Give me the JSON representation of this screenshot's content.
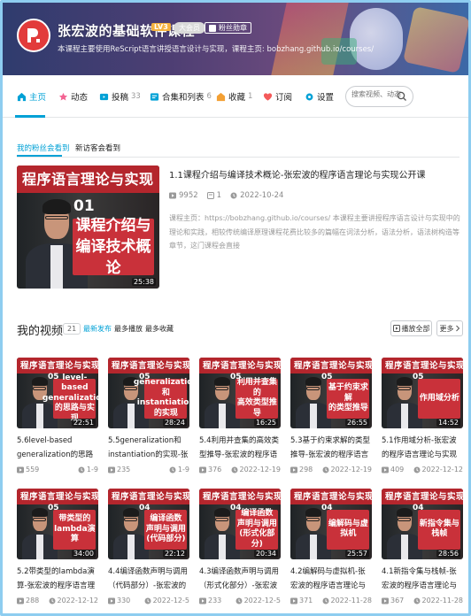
{
  "banner": {
    "username": "张宏波的基础软件课程",
    "level": "LV3",
    "vip_badge": "大会员",
    "fans_badge": "粉丝勋章",
    "signature": "本课程主要使用ReScript语言讲授语言设计与实现，课程主页: bobzhang.github.io/courses/"
  },
  "nav": {
    "items": [
      {
        "label": "主页",
        "count": ""
      },
      {
        "label": "动态",
        "count": ""
      },
      {
        "label": "投稿",
        "count": "33"
      },
      {
        "label": "合集和列表",
        "count": "6"
      },
      {
        "label": "收藏",
        "count": "1"
      },
      {
        "label": "订阅",
        "count": ""
      },
      {
        "label": "设置",
        "count": ""
      }
    ],
    "search_placeholder": "搜索视频、动态"
  },
  "subtabs": [
    "我的粉丝会看到",
    "新访客会看到"
  ],
  "featured": {
    "thumb_bar": "程序语言理论与实现",
    "thumb_num": "01",
    "thumb_box": [
      "课程介绍与",
      "编译技术概论"
    ],
    "duration": "25:38",
    "title": "1.1课程介绍与编译技术概论-张宏波的程序语言理论与实现公开课",
    "views": "9952",
    "comments": "1",
    "date": "2022-10-24",
    "description": "课程主页：https://bobzhang.github.io/courses/ 本课程主要讲授程序语言设计与实现中的理论和实践，相较传统编译原理课程花费比较多的篇幅在词法分析，语法分析，语法树构造等章节，这门课程会直接"
  },
  "section": {
    "title": "我的视频",
    "count": "21",
    "tabs": [
      "最新发布",
      "最多播放",
      "最多收藏"
    ],
    "play_all": "播放全部",
    "more": "更多"
  },
  "videos": [
    {
      "bar": "程序语言理论与实现",
      "num": "05",
      "box": [
        "level-based",
        "generalization",
        "的思路与实现"
      ],
      "duration": "22:51",
      "title": "5.6level-based generalization的思路与实现-",
      "views": "559",
      "date": "1-9"
    },
    {
      "bar": "程序语言理论与实现",
      "num": "05",
      "box": [
        "generalization和",
        "instantiation的实现"
      ],
      "duration": "28:24",
      "title": "5.5generalization和instantiation的实现-张宏波",
      "views": "235",
      "date": "1-9"
    },
    {
      "bar": "程序语言理论与实现",
      "num": "05",
      "box": [
        "利用并查集的",
        "高效类型推导"
      ],
      "duration": "16:25",
      "title": "5.4利用并查集的高效类型推导-张宏波的程序语",
      "views": "376",
      "date": "2022-12-19"
    },
    {
      "bar": "程序语言理论与实现",
      "num": "05",
      "box": [
        "基于约束求解",
        "的类型推导"
      ],
      "duration": "26:55",
      "title": "5.3基于约束求解的类型推导-张宏波的程序语言理论与实现公开课",
      "views": "298",
      "date": "2022-12-19"
    },
    {
      "bar": "程序语言理论与实现",
      "num": "05",
      "box": [
        "作用域分析"
      ],
      "duration": "14:52",
      "title": "5.1作用域分析-张宏波的程序语言理论与实现公开课",
      "views": "409",
      "date": "2022-12-12"
    },
    {
      "bar": "程序语言理论与实现",
      "num": "05",
      "box": [
        "带类型的",
        "lambda演算"
      ],
      "duration": "34:00",
      "title": "5.2带类型的lambda演算-张宏波的程序语言理论与实现公",
      "views": "288",
      "date": "2022-12-12"
    },
    {
      "bar": "程序语言理论与实现",
      "num": "04",
      "box": [
        "编译函数",
        "声明与调用",
        "(代码部分)"
      ],
      "duration": "22:12",
      "title": "4.4编译函数声明与调用（代码部分）-张宏波的程序语言",
      "views": "330",
      "date": "2022-12-5"
    },
    {
      "bar": "程序语言理论与实现",
      "num": "04",
      "box": [
        "编译函数",
        "声明与调用",
        "(形式化部分)"
      ],
      "duration": "20:34",
      "title": "4.3编译函数声明与调用（形式化部分）-张宏波的程序语",
      "views": "233",
      "date": "2022-12-5"
    },
    {
      "bar": "程序语言理论与实现",
      "num": "04",
      "box": [
        "编解码与虚拟机"
      ],
      "duration": "25:57",
      "title": "4.2编解码与虚拟机-张宏波的程序语言理论与实现公开课",
      "views": "371",
      "date": "2022-11-28"
    },
    {
      "bar": "程序语言理论与实现",
      "num": "04",
      "box": [
        "新指令集与栈帧"
      ],
      "duration": "28:56",
      "title": "4.1新指令集与栈帧-张宏波的程序语言理论与实现公开课",
      "views": "367",
      "date": "2022-11-28"
    }
  ],
  "colors": {
    "accent": "#00a1d6",
    "thumb_red": "#c9313a",
    "banner": "#4d3e73"
  }
}
